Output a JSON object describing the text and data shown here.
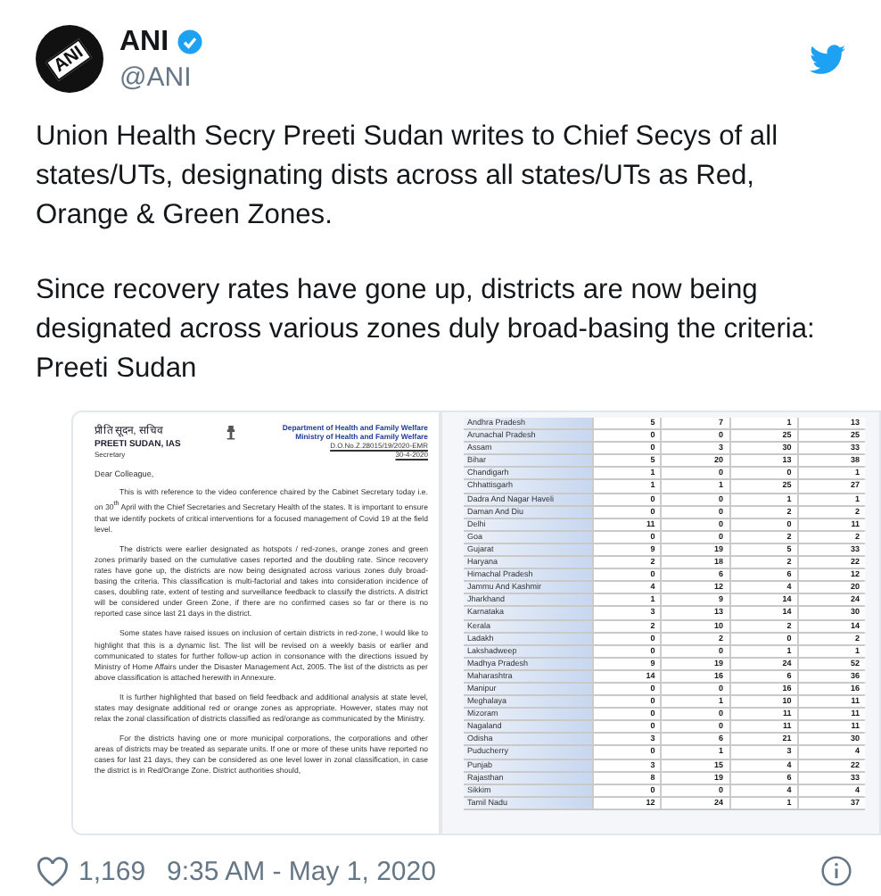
{
  "author": {
    "avatar_logo": "ANI",
    "name": "ANI",
    "verified": true,
    "handle": "@ANI"
  },
  "tweet_paragraphs": [
    "Union Health Secry Preeti Sudan writes to Chief Secys of all states/UTs, designating dists across all states/UTs as Red, Orange & Green Zones.",
    "Since recovery rates have gone up, districts are now being designated across various zones duly broad-basing the criteria: Preeti Sudan"
  ],
  "letter": {
    "sender_hindi": "प्रीति सूदन, सचिव",
    "sender": "PREETI SUDAN, IAS",
    "sender_title": "Secretary",
    "department": "Department of Health and Family Welfare",
    "ministry": "Ministry of Health and Family Welfare",
    "reference": "D.O.No.Z.28015/19/2020-EMR",
    "date": "30-4-2020",
    "salutation": "Dear Colleague,",
    "paragraphs": [
      "This is with reference to the video conference chaired by the Cabinet Secretary today i.e. on 30$^{th}$ April with the Chief Secretaries and Secretary Health of the states. It is important to ensure that we identify pockets of critical interventions for a focused management of Covid 19 at the field level.",
      "The districts were earlier designated as hotspots / red-zones, orange zones and green zones primarily based on the cumulative cases reported and the doubling rate. Since recovery rates have gone up, the districts are now being designated across various zones duly broad-basing the criteria. This classification is multi-factorial and takes into consideration incidence of cases, doubling rate, extent of testing and surveillance feedback to classify the districts. A district will be considered under Green Zone, if there are no confirmed cases so far or there is no reported case since last 21 days in the district.",
      "Some states have raised issues on inclusion of certain districts in red-zone, I would like to highlight that this is a dynamic list. The list will be revised on a weekly basis or earlier and communicated to states for further follow-up action in consonance with the directions issued by Ministry of Home Affairs under the Disaster Management Act, 2005. The list of the districts as per above classification is attached herewith in Annexure.",
      "It is further highlighted that based on field feedback and additional analysis at state level, states may designate additional red or orange zones as appropriate. However, states may not relax the zonal classification of districts classified as red/orange as communicated by the Ministry.",
      "For the districts having one or more municipal corporations, the corporations and other areas of districts may be treated as separate units. If one or more of these units have reported no cases for last 21 days, they can be considered as one level lower in zonal classification, in case the district is in Red/Orange Zone. District authorities should,"
    ]
  },
  "table": {
    "rows": [
      [
        "Andhra Pradesh",
        "5",
        "7",
        "1",
        "13"
      ],
      [
        "Arunachal Pradesh",
        "0",
        "0",
        "25",
        "25"
      ],
      [
        "Assam",
        "0",
        "3",
        "30",
        "33"
      ],
      [
        "Bihar",
        "5",
        "20",
        "13",
        "38"
      ],
      [
        "Chandigarh",
        "1",
        "0",
        "0",
        "1"
      ],
      [
        "Chhattisgarh",
        "1",
        "1",
        "25",
        "27"
      ],
      [
        "Dadra And Nagar Haveli",
        "0",
        "0",
        "1",
        "1"
      ],
      [
        "Daman And Diu",
        "0",
        "0",
        "2",
        "2"
      ],
      [
        "Delhi",
        "11",
        "0",
        "0",
        "11"
      ],
      [
        "Goa",
        "0",
        "0",
        "2",
        "2"
      ],
      [
        "Gujarat",
        "9",
        "19",
        "5",
        "33"
      ],
      [
        "Haryana",
        "2",
        "18",
        "2",
        "22"
      ],
      [
        "Himachal Pradesh",
        "0",
        "6",
        "6",
        "12"
      ],
      [
        "Jammu And Kashmir",
        "4",
        "12",
        "4",
        "20"
      ],
      [
        "Jharkhand",
        "1",
        "9",
        "14",
        "24"
      ],
      [
        "Karnataka",
        "3",
        "13",
        "14",
        "30"
      ],
      [
        "Kerala",
        "2",
        "10",
        "2",
        "14"
      ],
      [
        "Ladakh",
        "0",
        "2",
        "0",
        "2"
      ],
      [
        "Lakshadweep",
        "0",
        "0",
        "1",
        "1"
      ],
      [
        "Madhya Pradesh",
        "9",
        "19",
        "24",
        "52"
      ],
      [
        "Maharashtra",
        "14",
        "16",
        "6",
        "36"
      ],
      [
        "Manipur",
        "0",
        "0",
        "16",
        "16"
      ],
      [
        "Meghalaya",
        "0",
        "1",
        "10",
        "11"
      ],
      [
        "Mizoram",
        "0",
        "0",
        "11",
        "11"
      ],
      [
        "Nagaland",
        "0",
        "0",
        "11",
        "11"
      ],
      [
        "Odisha",
        "3",
        "6",
        "21",
        "30"
      ],
      [
        "Puducherry",
        "0",
        "1",
        "3",
        "4"
      ],
      [
        "Punjab",
        "3",
        "15",
        "4",
        "22"
      ],
      [
        "Rajasthan",
        "8",
        "19",
        "6",
        "33"
      ],
      [
        "Sikkim",
        "0",
        "0",
        "4",
        "4"
      ],
      [
        "Tamil Nadu",
        "12",
        "24",
        "1",
        "37"
      ]
    ]
  },
  "likes": "1,169",
  "timestamp": "9:35 AM - May 1, 2020"
}
